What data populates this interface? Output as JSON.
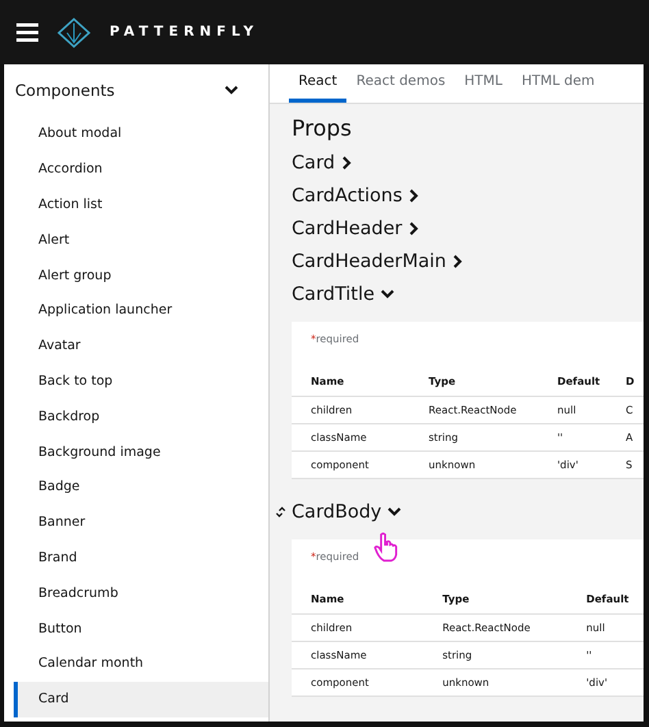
{
  "header": {
    "brand": "PATTERNFLY"
  },
  "sidebar": {
    "title": "Components",
    "expanded": true,
    "items": [
      {
        "label": "About modal",
        "selected": false
      },
      {
        "label": "Accordion",
        "selected": false
      },
      {
        "label": "Action list",
        "selected": false
      },
      {
        "label": "Alert",
        "selected": false
      },
      {
        "label": "Alert group",
        "selected": false
      },
      {
        "label": "Application launcher",
        "selected": false
      },
      {
        "label": "Avatar",
        "selected": false
      },
      {
        "label": "Back to top",
        "selected": false
      },
      {
        "label": "Backdrop",
        "selected": false
      },
      {
        "label": "Background image",
        "selected": false
      },
      {
        "label": "Badge",
        "selected": false
      },
      {
        "label": "Banner",
        "selected": false
      },
      {
        "label": "Brand",
        "selected": false
      },
      {
        "label": "Breadcrumb",
        "selected": false
      },
      {
        "label": "Button",
        "selected": false
      },
      {
        "label": "Calendar month",
        "selected": false
      },
      {
        "label": "Card",
        "selected": true
      }
    ]
  },
  "tabs": [
    {
      "label": "React",
      "selected": true
    },
    {
      "label": "React demos",
      "selected": false
    },
    {
      "label": "HTML",
      "selected": false
    },
    {
      "label": "HTML dem",
      "selected": false
    }
  ],
  "title": "Props",
  "sections": [
    {
      "name": "Card",
      "expanded": false,
      "link": false
    },
    {
      "name": "CardActions",
      "expanded": false,
      "link": false
    },
    {
      "name": "CardHeader",
      "expanded": false,
      "link": false
    },
    {
      "name": "CardHeaderMain",
      "expanded": false,
      "link": false
    },
    {
      "name": "CardTitle",
      "expanded": true,
      "link": false,
      "required_marker": "*",
      "required_note": "required",
      "columns": [
        "Name",
        "Type",
        "Default",
        "D"
      ],
      "rows": [
        [
          "children",
          "React.ReactNode",
          "null",
          "C"
        ],
        [
          "className",
          "string",
          "''",
          "A"
        ],
        [
          "component",
          "unknown",
          "'div'",
          "S"
        ]
      ]
    },
    {
      "name": "CardBody",
      "expanded": true,
      "link": true,
      "required_marker": "*",
      "required_note": "required",
      "columns": [
        "Name",
        "Type",
        "Default"
      ],
      "rows": [
        [
          "children",
          "React.ReactNode",
          "null"
        ],
        [
          "className",
          "string",
          "''"
        ],
        [
          "component",
          "unknown",
          "'div'"
        ]
      ]
    }
  ]
}
